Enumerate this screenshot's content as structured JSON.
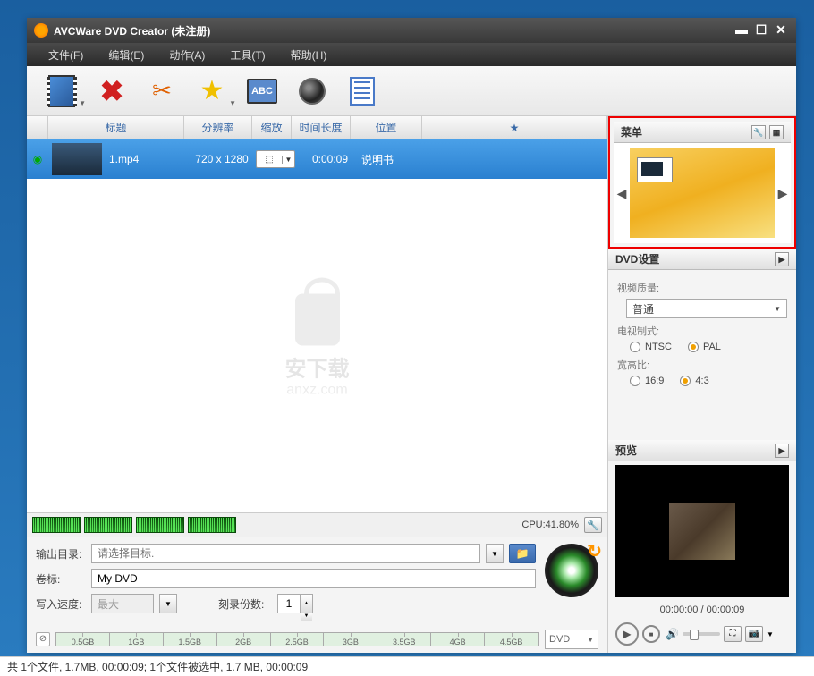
{
  "window": {
    "title": "AVCWare DVD Creator (未注册)"
  },
  "menubar": {
    "file": "文件(F)",
    "edit": "编辑(E)",
    "action": "动作(A)",
    "tools": "工具(T)",
    "help": "帮助(H)"
  },
  "toolbar": {
    "abc": "ABC"
  },
  "columns": {
    "title": "标题",
    "resolution": "分辨率",
    "scale": "缩放",
    "duration": "时间长度",
    "position": "位置",
    "star": "★"
  },
  "file": {
    "name": "1.mp4",
    "resolution": "720 x 1280",
    "scale": "⬚",
    "duration": "0:00:09",
    "manual": "说明书"
  },
  "watermark": {
    "line1": "安下载",
    "line2": "anxz.com"
  },
  "cpu": {
    "label": "CPU:41.80%"
  },
  "output": {
    "dir_label": "输出目录:",
    "dir_placeholder": "请选择目标.",
    "vol_label": "卷标:",
    "vol_value": "My DVD",
    "speed_label": "写入速度:",
    "speed_value": "最大",
    "copies_label": "刻录份数:",
    "copies_value": "1"
  },
  "ruler": {
    "segs": [
      "0.5GB",
      "1GB",
      "1.5GB",
      "2GB",
      "2.5GB",
      "3GB",
      "3.5GB",
      "4GB",
      "4.5GB"
    ],
    "dvd": "DVD"
  },
  "right": {
    "menu_header": "菜单",
    "settings_header": "DVD设置",
    "quality_label": "视频质量:",
    "quality_value": "普通",
    "tv_label": "电视制式:",
    "tv_ntsc": "NTSC",
    "tv_pal": "PAL",
    "aspect_label": "宽高比:",
    "aspect_169": "16:9",
    "aspect_43": "4:3",
    "preview_header": "预览",
    "time": "00:00:00 / 00:00:09"
  },
  "status": "共 1个文件, 1.7MB,  00:00:09; 1个文件被选中, 1.7 MB,  00:00:09"
}
